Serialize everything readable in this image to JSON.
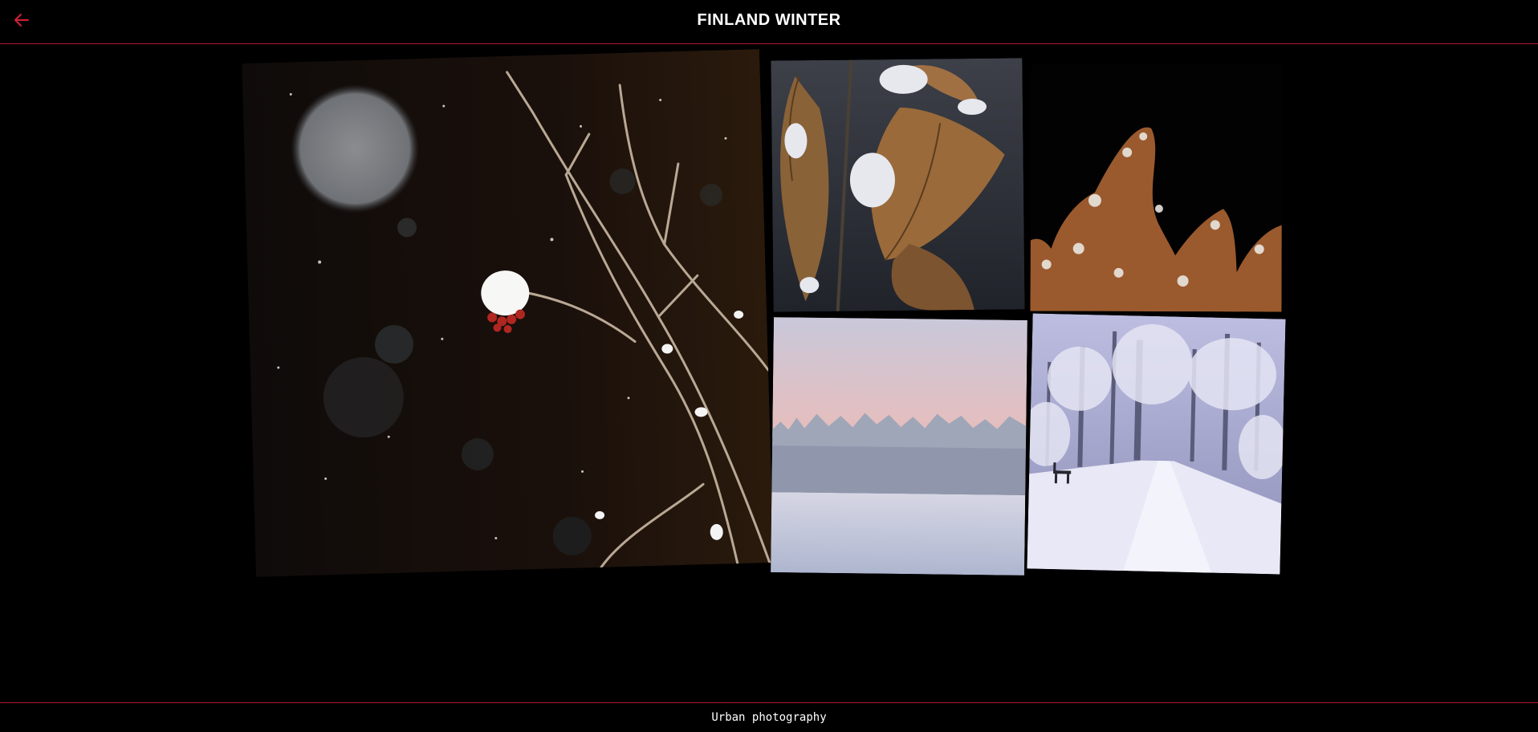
{
  "header": {
    "title": "FINLAND WINTER",
    "back_icon": "arrow-left-icon",
    "accent_color": "#b0182e"
  },
  "gallery": {
    "photos": [
      {
        "name": "night-berries-branch"
      },
      {
        "name": "snowy-oak-leaves"
      },
      {
        "name": "frosted-brown-shrub"
      },
      {
        "name": "frozen-lake-sunset"
      },
      {
        "name": "snowy-forest-path"
      }
    ]
  },
  "footer": {
    "text": "Urban photography"
  }
}
